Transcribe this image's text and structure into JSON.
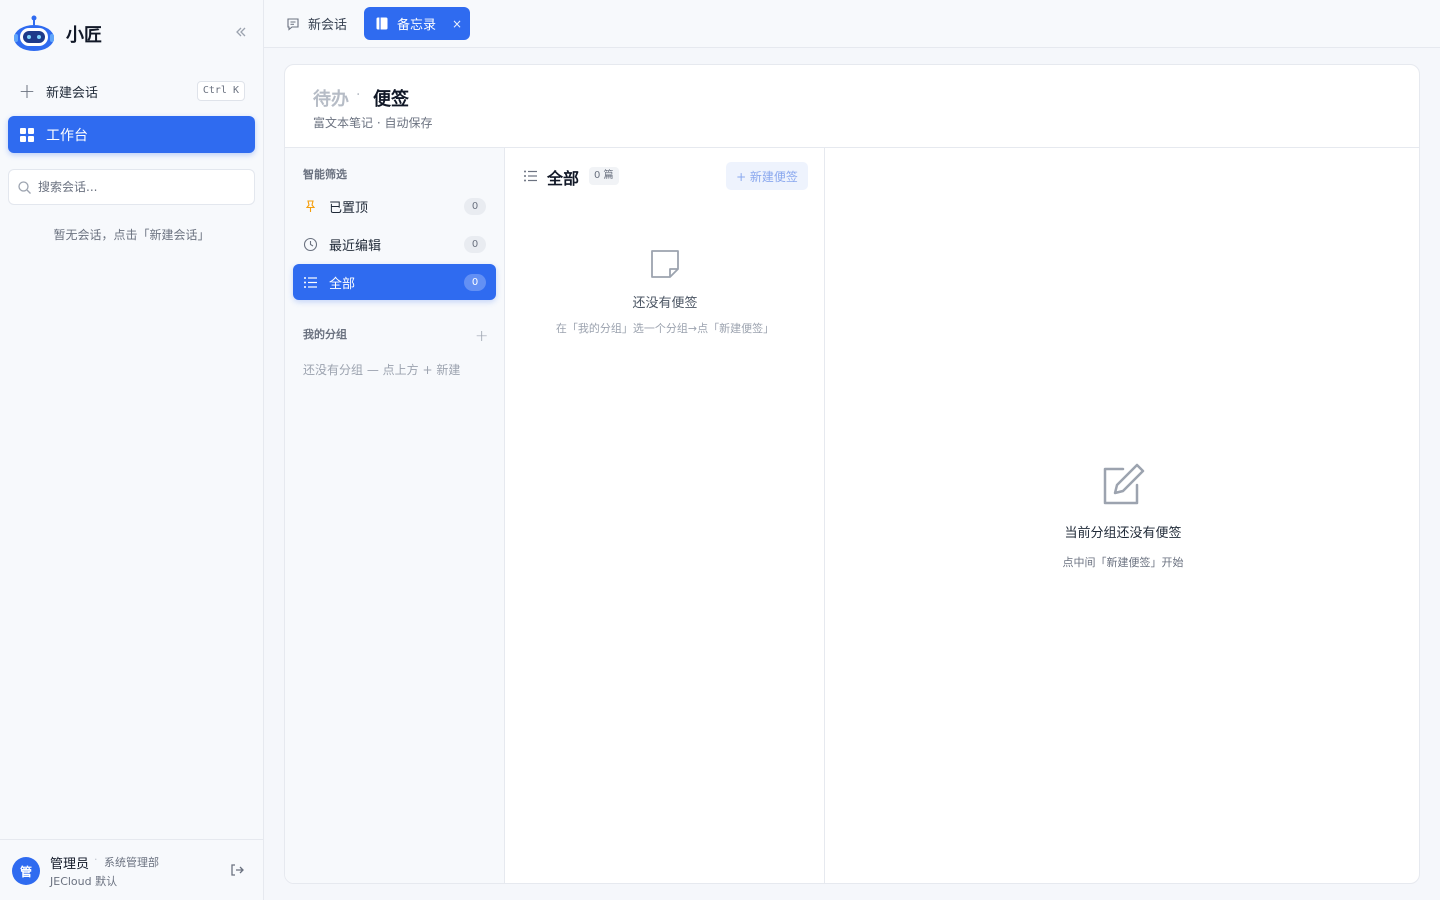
{
  "brand": {
    "name": "小匠",
    "logo_icon": "robot-logo-icon"
  },
  "sidebar": {
    "collapse_icon": "double-chevron-left-icon",
    "new_chat": {
      "label": "新建会话",
      "shortcut": "Ctrl K"
    },
    "workbench": {
      "label": "工作台"
    },
    "search": {
      "placeholder": "搜索会话..."
    },
    "empty_text": "暂无会话，点击「新建会话」"
  },
  "user": {
    "avatar_text": "管",
    "name": "管理员",
    "separator": "·",
    "department": "系统管理部",
    "org": "JECloud 默认",
    "logout_icon": "logout-icon"
  },
  "tabs": [
    {
      "label": "新会话",
      "icon": "chat-bubble-icon",
      "active": false
    },
    {
      "label": "备忘录",
      "icon": "notebook-icon",
      "active": true,
      "close": "×"
    }
  ],
  "page": {
    "breadcrumb_todo": "待办",
    "breadcrumb_dot": "·",
    "breadcrumb_memo": "便签",
    "subtitle": "富文本笔记 · 自动保存"
  },
  "filters": {
    "smart_title": "智能筛选",
    "items": [
      {
        "label": "已置顶",
        "count": "0",
        "icon": "pin-icon"
      },
      {
        "label": "最近编辑",
        "count": "0",
        "icon": "clock-icon"
      },
      {
        "label": "全部",
        "count": "0",
        "icon": "list-icon",
        "active": true
      }
    ],
    "groups_title": "我的分组",
    "add_group": "+",
    "no_group": "还没有分组 — 点上方 + 新建"
  },
  "list": {
    "title": "全部",
    "count": "0 篇",
    "new_button": "+ 新建便签",
    "empty_title": "还没有便签",
    "empty_hint": "在「我的分组」选一个分组→点「新建便签」"
  },
  "detail": {
    "empty_title": "当前分组还没有便签",
    "empty_hint": "点中间「新建便签」开始"
  },
  "colors": {
    "accent": "#2f6bf0",
    "pin": "#f59e0b"
  }
}
